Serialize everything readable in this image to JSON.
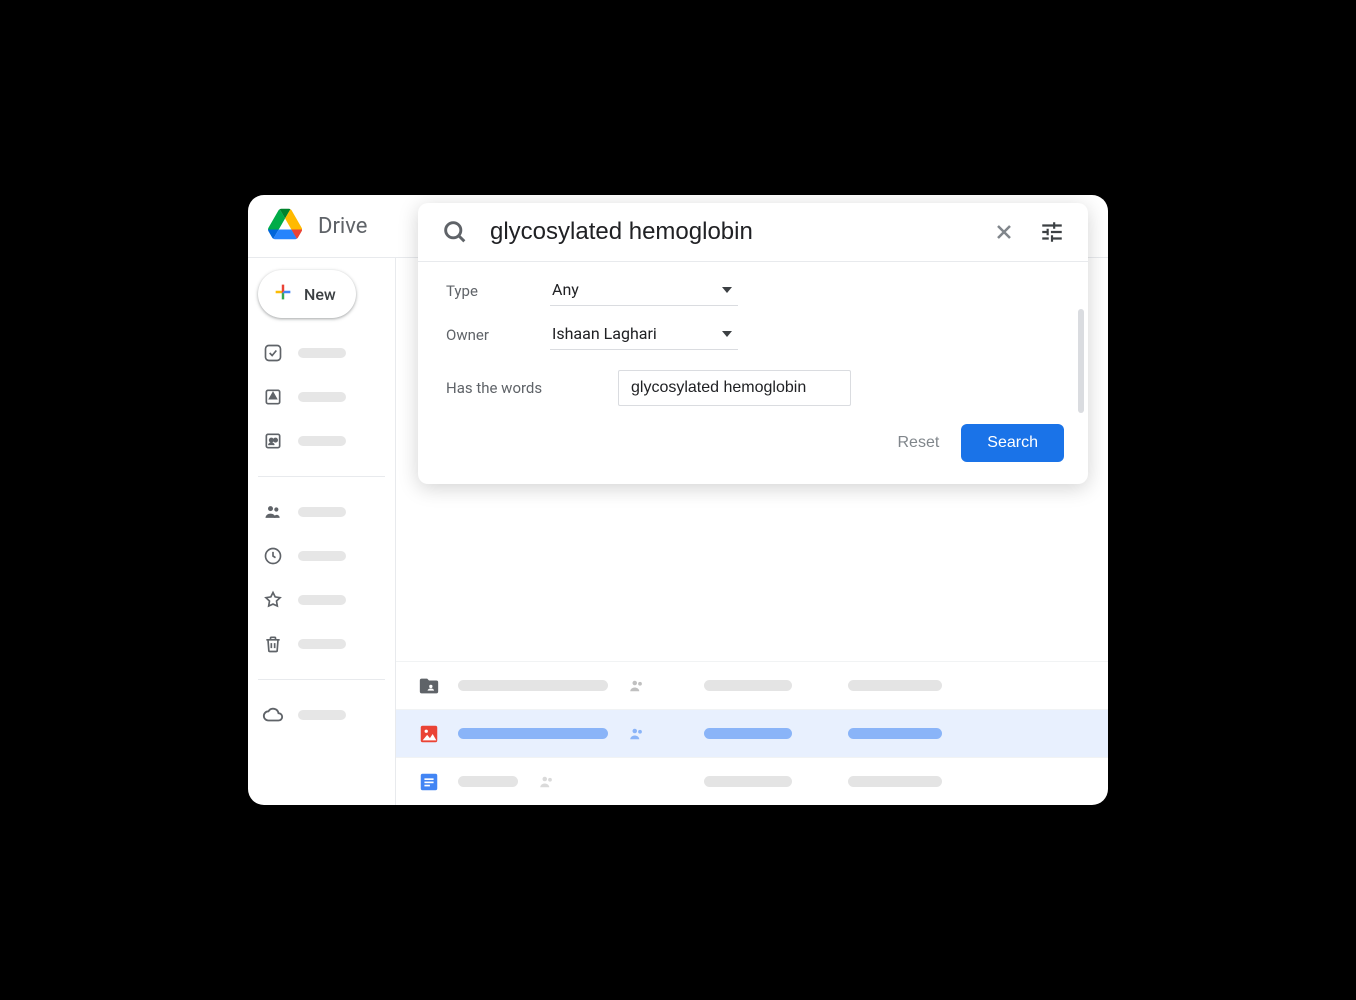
{
  "app": {
    "title": "Drive"
  },
  "sidebar": {
    "new_label": "New"
  },
  "search": {
    "query": "glycosylated hemoglobin",
    "filters": {
      "type_label": "Type",
      "type_value": "Any",
      "owner_label": "Owner",
      "owner_value": "Ishaan Laghari",
      "words_label": "Has the words",
      "words_value": "glycosylated hemoglobin"
    },
    "reset_label": "Reset",
    "search_label": "Search"
  }
}
